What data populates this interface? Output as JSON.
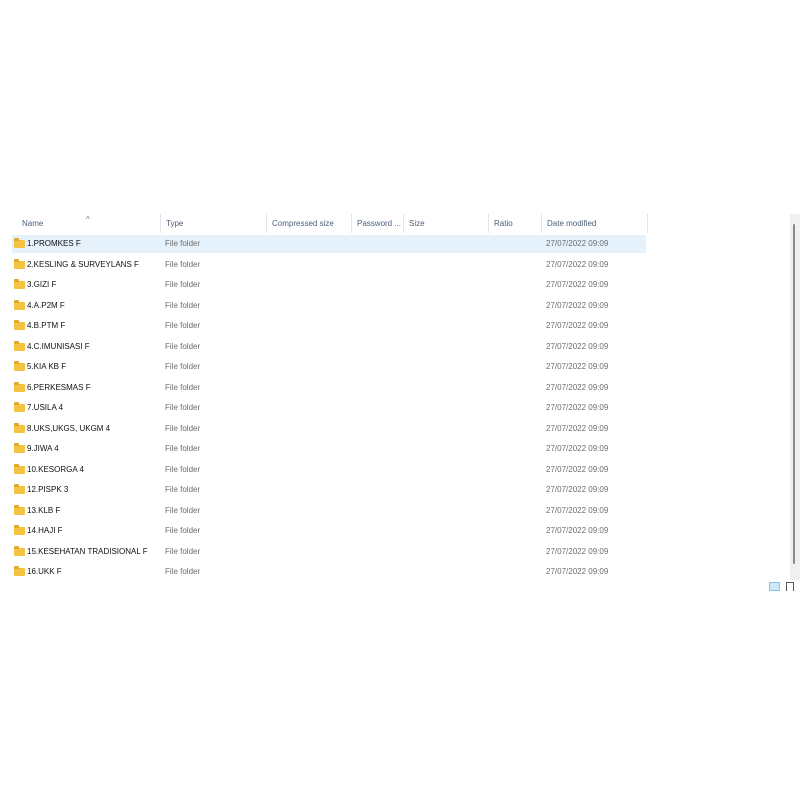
{
  "columns": [
    "Name",
    "Type",
    "Compressed size",
    "Password ...",
    "Size",
    "Ratio",
    "Date modified"
  ],
  "rows": [
    {
      "name": "1.PROMKES F",
      "type": "File folder",
      "date": "27/07/2022 09:09"
    },
    {
      "name": "2.KESLING & SURVEYLANS F",
      "type": "File folder",
      "date": "27/07/2022 09:09"
    },
    {
      "name": "3.GIZI F",
      "type": "File folder",
      "date": "27/07/2022 09:09"
    },
    {
      "name": "4.A.P2M F",
      "type": "File folder",
      "date": "27/07/2022 09:09"
    },
    {
      "name": "4.B.PTM F",
      "type": "File folder",
      "date": "27/07/2022 09:09"
    },
    {
      "name": "4.C.IMUNISASI F",
      "type": "File folder",
      "date": "27/07/2022 09:09"
    },
    {
      "name": "5.KIA KB F",
      "type": "File folder",
      "date": "27/07/2022 09:09"
    },
    {
      "name": "6.PERKESMAS F",
      "type": "File folder",
      "date": "27/07/2022 09:09"
    },
    {
      "name": "7.USILA 4",
      "type": "File folder",
      "date": "27/07/2022 09:09"
    },
    {
      "name": "8.UKS,UKGS, UKGM 4",
      "type": "File folder",
      "date": "27/07/2022 09:09"
    },
    {
      "name": "9.JIWA 4",
      "type": "File folder",
      "date": "27/07/2022 09:09"
    },
    {
      "name": "10.KESORGA 4",
      "type": "File folder",
      "date": "27/07/2022 09:09"
    },
    {
      "name": "12.PISPK 3",
      "type": "File folder",
      "date": "27/07/2022 09:09"
    },
    {
      "name": "13.KLB F",
      "type": "File folder",
      "date": "27/07/2022 09:09"
    },
    {
      "name": "14.HAJI F",
      "type": "File folder",
      "date": "27/07/2022 09:09"
    },
    {
      "name": "15.KESEHATAN TRADISIONAL F",
      "type": "File folder",
      "date": "27/07/2022 09:09"
    },
    {
      "name": "16.UKK F",
      "type": "File folder",
      "date": "27/07/2022 09:09"
    }
  ]
}
